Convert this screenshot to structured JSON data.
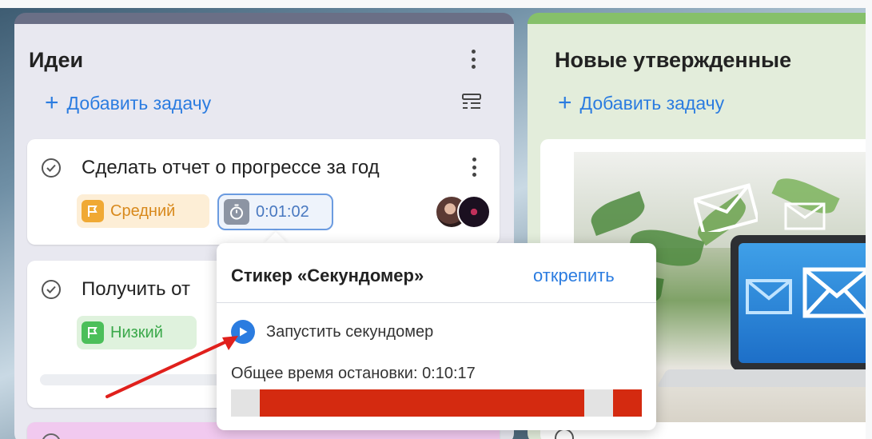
{
  "board": {
    "columns": [
      {
        "title": "Идеи",
        "add_task": "Добавить задачу",
        "cards": [
          {
            "title": "Сделать отчет о прогрессе за год",
            "priority": "Средний",
            "priority_color": "#f0a934",
            "timer": "0:01:02"
          },
          {
            "title": "Получить от",
            "priority": "Низкий",
            "priority_color": "#4cbf5a"
          }
        ]
      },
      {
        "title": "Новые утвержденные",
        "add_task": "Добавить задачу"
      }
    ]
  },
  "popover": {
    "title": "Стикер «Секундомер»",
    "unpin": "открепить",
    "start": "Запустить секундомер",
    "total_label": "Общее время остановки: 0:10:17",
    "bar_segments": [
      {
        "start": 0.07,
        "end": 0.86
      },
      {
        "start": 0.93,
        "end": 1.0
      }
    ]
  },
  "colors": {
    "accent": "#2b7ce0",
    "bar_fill": "#d42a10",
    "column1_header": "#6a6f86",
    "column2_header": "#86c06a",
    "annotation_arrow": "#e0201c"
  },
  "icons": {
    "card_menu": "kebab-icon",
    "add": "plus-icon",
    "check": "check-circle-icon",
    "priority": "flag-icon",
    "timer": "stopwatch-icon",
    "play": "play-icon",
    "list_view": "list-view-icon"
  }
}
